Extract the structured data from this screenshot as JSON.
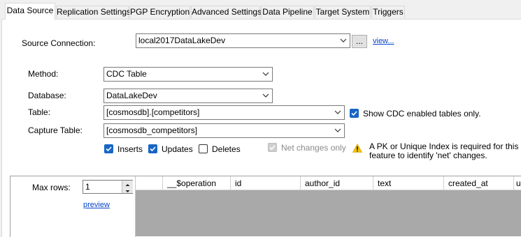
{
  "tabs": [
    {
      "label": "Data Source"
    },
    {
      "label": "Replication Settings"
    },
    {
      "label": "PGP Encryption"
    },
    {
      "label": "Advanced Settings"
    },
    {
      "label": "Data Pipeline"
    },
    {
      "label": "Target System"
    },
    {
      "label": "Triggers"
    }
  ],
  "source": {
    "label": "Source Connection:",
    "value": "local2017DataLakeDev",
    "browse_label": "...",
    "view_link": "view..."
  },
  "method": {
    "label": "Method:",
    "value": "CDC Table"
  },
  "database": {
    "label": "Database:",
    "value": "DataLakeDev"
  },
  "table": {
    "label": "Table:",
    "value": "[cosmosdb].[competitors]",
    "show_cdc_label": "Show CDC enabled tables only.",
    "show_cdc_checked": true
  },
  "capture": {
    "label": "Capture Table:",
    "value": "[cosmosdb_competitors]"
  },
  "options": {
    "inserts": {
      "label": "Inserts",
      "checked": true
    },
    "updates": {
      "label": "Updates",
      "checked": true
    },
    "deletes": {
      "label": "Deletes",
      "checked": false
    },
    "net_changes": {
      "label": "Net changes only",
      "checked": true,
      "disabled": true
    }
  },
  "warning": {
    "text_line1": "A PK or Unique Index is required for this",
    "text_line2": "feature to identify 'net' changes."
  },
  "preview": {
    "max_rows_label": "Max rows:",
    "max_rows_value": "1",
    "preview_link": "preview",
    "columns": [
      "__$operation",
      "id",
      "author_id",
      "text",
      "created_at",
      "u"
    ]
  },
  "colors": {
    "accent": "#1766c4",
    "link": "#0645c8",
    "grid_bg": "#a9a9a9",
    "warning": "#f2c200"
  }
}
